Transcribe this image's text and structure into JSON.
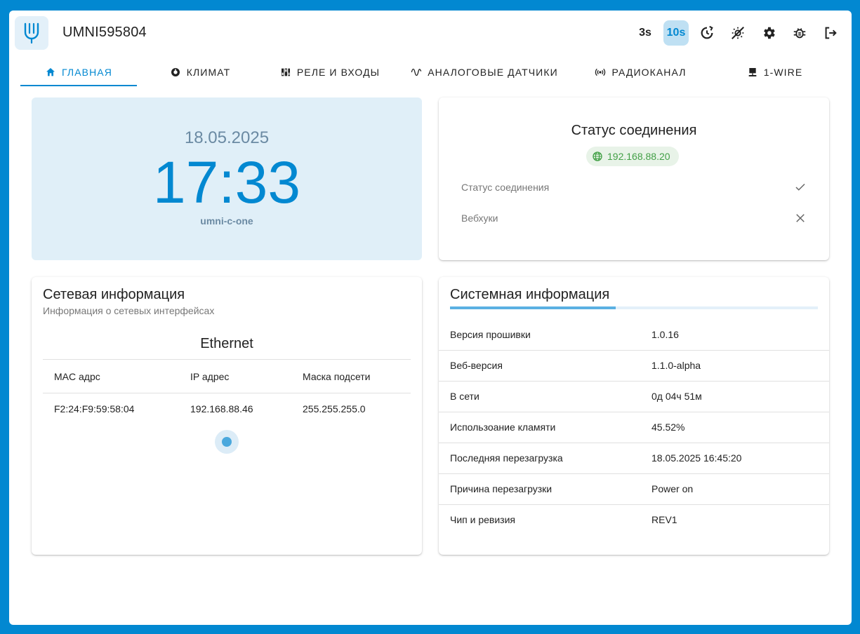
{
  "header": {
    "device_id": "UMNI595804",
    "refresh_3s": "3s",
    "refresh_10s": "10s"
  },
  "tabs": [
    {
      "label": "Главная",
      "icon": "home-icon"
    },
    {
      "label": "Климат",
      "icon": "thermostat-icon"
    },
    {
      "label": "Реле и входы",
      "icon": "relay-icon"
    },
    {
      "label": "Аналоговые датчики",
      "icon": "sine-wave-icon"
    },
    {
      "label": "Радиоканал",
      "icon": "radio-icon"
    },
    {
      "label": "1-wire",
      "icon": "network-icon"
    }
  ],
  "clock": {
    "date": "18.05.2025",
    "time": "17:33",
    "hostname": "umni-c-one"
  },
  "connection": {
    "title": "Статус соединения",
    "ip": "192.168.88.20",
    "rows": [
      {
        "label": "Статус соединения",
        "state": "check-icon"
      },
      {
        "label": "Вебхуки",
        "state": "close-icon"
      }
    ]
  },
  "network": {
    "title": "Сетевая информация",
    "subtitle": "Информация о сетевых интерфейсах",
    "interface": "Ethernet",
    "columns": [
      "MAC адрс",
      "IP адрес",
      "Маска подсети"
    ],
    "row": [
      "F2:24:F9:59:58:04",
      "192.168.88.46",
      "255.255.255.0"
    ]
  },
  "system": {
    "title": "Системная информация",
    "loading_progress": 0.45,
    "rows": [
      {
        "label": "Версия прошивки",
        "value": "1.0.16"
      },
      {
        "label": "Веб-версия",
        "value": "1.1.0-alpha"
      },
      {
        "label": "В сети",
        "value": "0д 04ч 51м"
      },
      {
        "label": "Использоание кламяти",
        "value": "45.52%"
      },
      {
        "label": "Последняя перезагрузка",
        "value": "18.05.2025 16:45:20"
      },
      {
        "label": "Причина перезагрузки",
        "value": "Power on"
      },
      {
        "label": "Чип и ревизия",
        "value": "REV1"
      }
    ]
  },
  "colors": {
    "accent": "#0288d1",
    "clock_bg": "#e0eff8",
    "ok_green": "#43a047"
  }
}
